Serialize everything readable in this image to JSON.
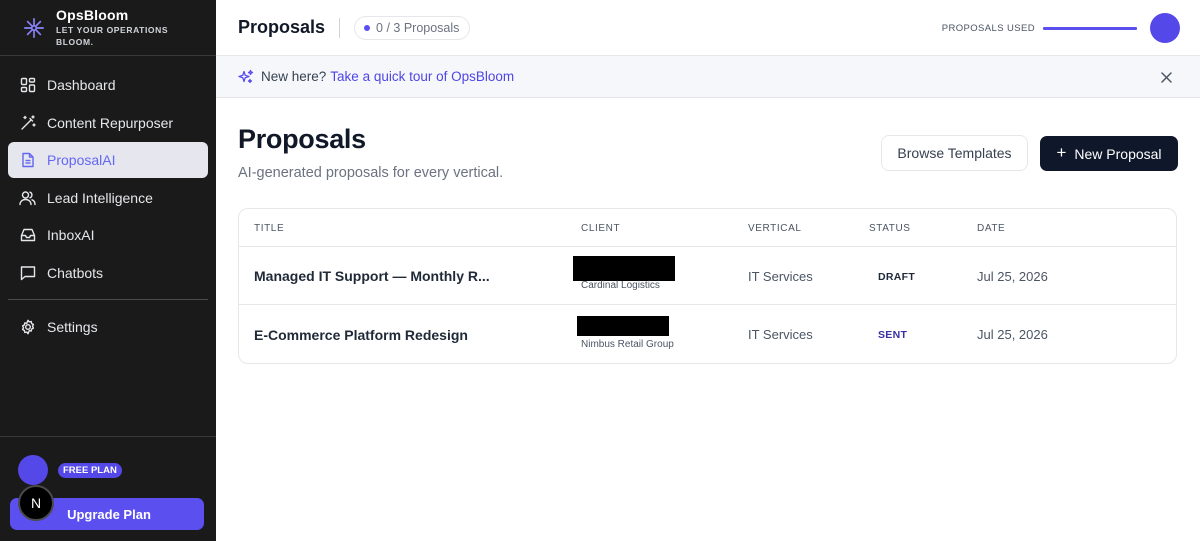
{
  "brand": {
    "name": "OpsBloom",
    "tagline_line1": "LET YOUR OPERATIONS",
    "tagline_line2": "BLOOM."
  },
  "sidebar": {
    "items": [
      {
        "label": "Dashboard",
        "icon": "dashboard-grid-icon"
      },
      {
        "label": "Content Repurposer",
        "icon": "magic-wand-icon"
      },
      {
        "label": "ProposalAI",
        "icon": "document-icon",
        "active": true
      },
      {
        "label": "Lead Intelligence",
        "icon": "users-icon"
      },
      {
        "label": "InboxAI",
        "icon": "inbox-icon"
      },
      {
        "label": "Chatbots",
        "icon": "chat-bubble-icon"
      }
    ],
    "settings_label": "Settings",
    "plan_badge": "FREE PLAN",
    "upgrade_label": "Upgrade Plan",
    "n_badge": "N"
  },
  "topbar": {
    "title": "Proposals",
    "count_label": "0 / 3 Proposals",
    "usage_label": "PROPOSALS USED",
    "usage_fraction": 1.0
  },
  "banner": {
    "text": "New here?",
    "link": "Take a quick tour of OpsBloom"
  },
  "page": {
    "title": "Proposals",
    "subtitle": "AI-generated proposals for every vertical.",
    "browse_label": "Browse Templates",
    "new_label": "New Proposal"
  },
  "table": {
    "headers": {
      "title": "TITLE",
      "client": "CLIENT",
      "vertical": "VERTICAL",
      "status": "STATUS",
      "date": "DATE"
    },
    "rows": [
      {
        "title": "Managed IT Support — Monthly R...",
        "client_sub": "Cardinal Logistics",
        "vertical": "IT Services",
        "status": "DRAFT",
        "date": "Jul 25, 2026"
      },
      {
        "title": "E-Commerce Platform Redesign",
        "client_sub": "Nimbus Retail Group",
        "vertical": "IT Services",
        "status": "SENT",
        "date": "Jul 25, 2026"
      }
    ]
  },
  "colors": {
    "accent": "#5b4ff0",
    "sidebar_bg": "#1a1a1a",
    "status_draft": "#1e293b",
    "status_sent": "#3730a3"
  }
}
